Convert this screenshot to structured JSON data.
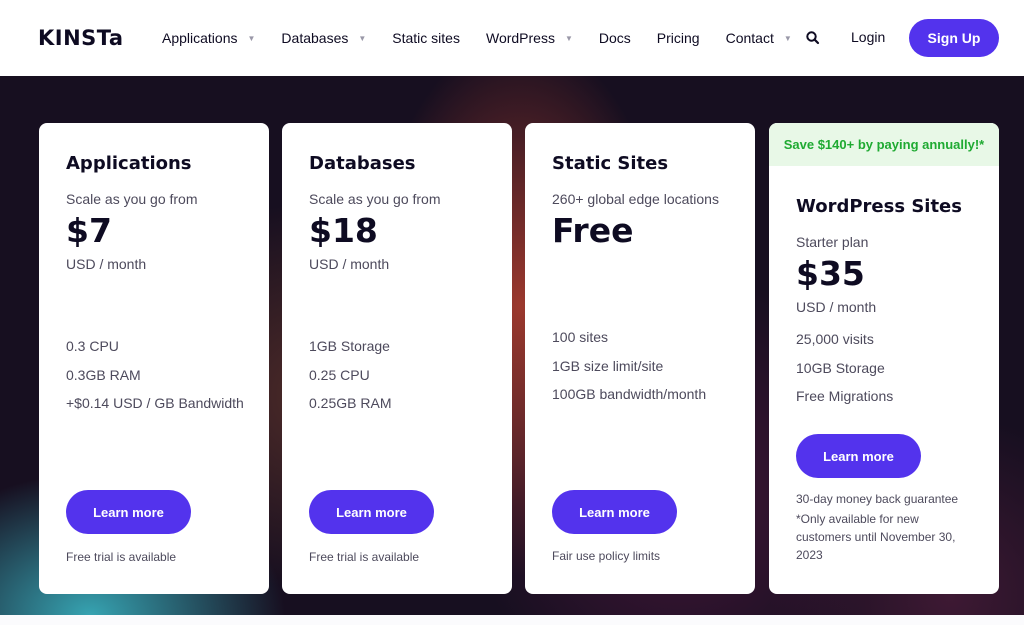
{
  "brand": {
    "logo": "KINSTa",
    "accent": "#5333ed",
    "promo_green": "#1faa32"
  },
  "nav": {
    "items": [
      {
        "label": "Applications",
        "has_dropdown": true
      },
      {
        "label": "Databases",
        "has_dropdown": true
      },
      {
        "label": "Static sites",
        "has_dropdown": false
      },
      {
        "label": "WordPress",
        "has_dropdown": true
      },
      {
        "label": "Docs",
        "has_dropdown": false
      },
      {
        "label": "Pricing",
        "has_dropdown": false
      },
      {
        "label": "Contact",
        "has_dropdown": true
      }
    ],
    "caret": "▼",
    "search_icon": "search-icon",
    "login_label": "Login",
    "signup_label": "Sign Up"
  },
  "cards": [
    {
      "title": "Applications",
      "subtitle": "Scale as you go from",
      "price": "$7",
      "unit": "USD  / month",
      "features": [
        "0.3 CPU",
        "0.3GB RAM",
        "+$0.14 USD / GB Bandwidth"
      ],
      "button_label": "Learn more",
      "note": "Free trial is available"
    },
    {
      "title": "Databases",
      "subtitle": "Scale as you go from",
      "price": "$18",
      "unit": "USD  / month",
      "features": [
        "1GB Storage",
        "0.25 CPU",
        "0.25GB RAM"
      ],
      "button_label": "Learn more",
      "note": "Free trial is available"
    },
    {
      "title": "Static Sites",
      "subtitle": "260+ global edge locations",
      "price": "Free",
      "features": [
        "100 sites",
        "1GB size limit/site",
        "100GB bandwidth/month"
      ],
      "button_label": "Learn more",
      "note": "Fair use policy limits"
    },
    {
      "promo": "Save $140+ by paying annually!*",
      "title": "WordPress Sites",
      "subtitle": "Starter plan",
      "price": "$35",
      "unit": "USD  / month",
      "features": [
        "25,000 visits",
        "10GB Storage",
        "Free Migrations"
      ],
      "button_label": "Learn more",
      "note_line1": "30-day money back guarantee",
      "note_line2": "*Only available for new customers until November 30, 2023"
    }
  ]
}
